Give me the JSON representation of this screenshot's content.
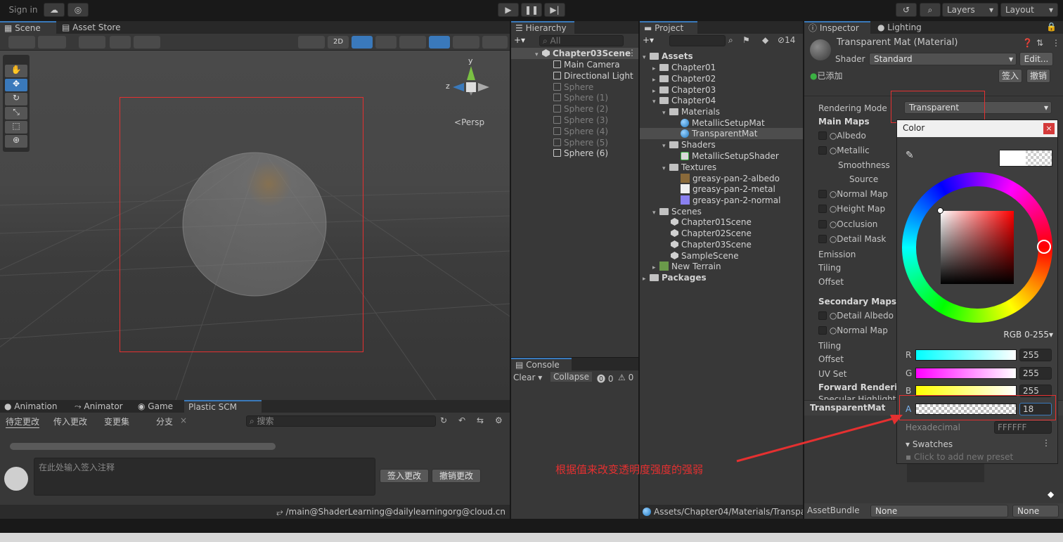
{
  "toolbar": {
    "sign_in": "Sign in",
    "layers": "Layers",
    "layout": "Layout"
  },
  "scene": {
    "tabs": [
      "Scene",
      "Asset Store"
    ],
    "btn_2d": "2D",
    "persp": "Persp",
    "gizmo_y": "y",
    "gizmo_z": "z"
  },
  "hierarchy": {
    "tab": "Hierarchy",
    "search_placeholder": "All",
    "root": "Chapter03Scene",
    "items": [
      {
        "label": "Main Camera",
        "dim": false
      },
      {
        "label": "Directional Light",
        "dim": false
      },
      {
        "label": "Sphere",
        "dim": true
      },
      {
        "label": "Sphere (1)",
        "dim": true
      },
      {
        "label": "Sphere (2)",
        "dim": true
      },
      {
        "label": "Sphere (3)",
        "dim": true
      },
      {
        "label": "Sphere (4)",
        "dim": true
      },
      {
        "label": "Sphere (5)",
        "dim": true
      },
      {
        "label": "Sphere (6)",
        "dim": false
      }
    ]
  },
  "project": {
    "tab": "Project",
    "hidden_count": "14",
    "assets": "Assets",
    "chapter01": "Chapter01",
    "chapter02": "Chapter02",
    "chapter03": "Chapter03",
    "chapter04": "Chapter04",
    "materials": "Materials",
    "metallic_mat": "MetallicSetupMat",
    "transparent_mat": "TransparentMat",
    "shaders": "Shaders",
    "metallic_shader": "MetallicSetupShader",
    "textures": "Textures",
    "tex_albedo": "greasy-pan-2-albedo",
    "tex_metal": "greasy-pan-2-metal",
    "tex_normal": "greasy-pan-2-normal",
    "scenes": "Scenes",
    "scene1": "Chapter01Scene",
    "scene2": "Chapter02Scene",
    "scene3": "Chapter03Scene",
    "scene4": "SampleScene",
    "terrain": "New Terrain",
    "packages": "Packages",
    "path": "Assets/Chapter04/Materials/Transpa"
  },
  "console": {
    "tab": "Console",
    "clear": "Clear",
    "collapse": "Collapse",
    "warn_count": "0",
    "err_count": "0"
  },
  "bottom": {
    "tabs": [
      "Animation",
      "Animator",
      "Game",
      "Plastic SCM"
    ],
    "subtabs": [
      "待定更改",
      "传入更改",
      "变更集",
      "分支"
    ],
    "search_placeholder": "搜索",
    "comment_placeholder": "在此处输入签入注释",
    "checkin_btn": "签入更改",
    "undo_btn": "撤销更改",
    "status_path": "/main@ShaderLearning@dailylearningorg@cloud.cn"
  },
  "inspector": {
    "tabs": [
      "Inspector",
      "Lighting"
    ],
    "material_title": "Transparent Mat (Material)",
    "shader_label": "Shader",
    "shader_value": "Standard",
    "edit_btn": "Edit...",
    "added": "已添加",
    "checkin": "签入",
    "undo": "撤销",
    "rendering_mode_label": "Rendering Mode",
    "rendering_mode_value": "Transparent",
    "main_maps": "Main Maps",
    "albedo": "Albedo",
    "metallic": "Metallic",
    "smoothness": "Smoothness",
    "source": "Source",
    "normal_map": "Normal Map",
    "height_map": "Height Map",
    "occlusion": "Occlusion",
    "detail_mask": "Detail Mask",
    "emission": "Emission",
    "tiling": "Tiling",
    "offset": "Offset",
    "secondary_maps": "Secondary Maps",
    "detail_albedo": "Detail Albedo x",
    "normal_map2": "Normal Map",
    "tiling2": "Tiling",
    "offset2": "Offset",
    "uv_set": "UV Set",
    "forward_rendering": "Forward Rendering",
    "specular": "Specular Highlights",
    "preview_name": "TransparentMat",
    "asset_bundle": "AssetBundle",
    "asset_bundle_value": "None",
    "asset_bundle_variant": "None"
  },
  "color_picker": {
    "title": "Color",
    "mode": "RGB 0-255",
    "r_label": "R",
    "r": "255",
    "g_label": "G",
    "g": "255",
    "b_label": "B",
    "b": "255",
    "a_label": "A",
    "a": "18",
    "hex_label": "Hexadecimal",
    "hex": "FFFFFF",
    "swatches": "Swatches",
    "preset_hint": "Click to add new preset"
  },
  "annotation": {
    "text": "根据值来改变透明度强度的强弱"
  },
  "colors": {
    "accent": "#3a79bb",
    "annotation_red": "#e53030",
    "panel": "#383838",
    "tab_bar": "#282828"
  }
}
